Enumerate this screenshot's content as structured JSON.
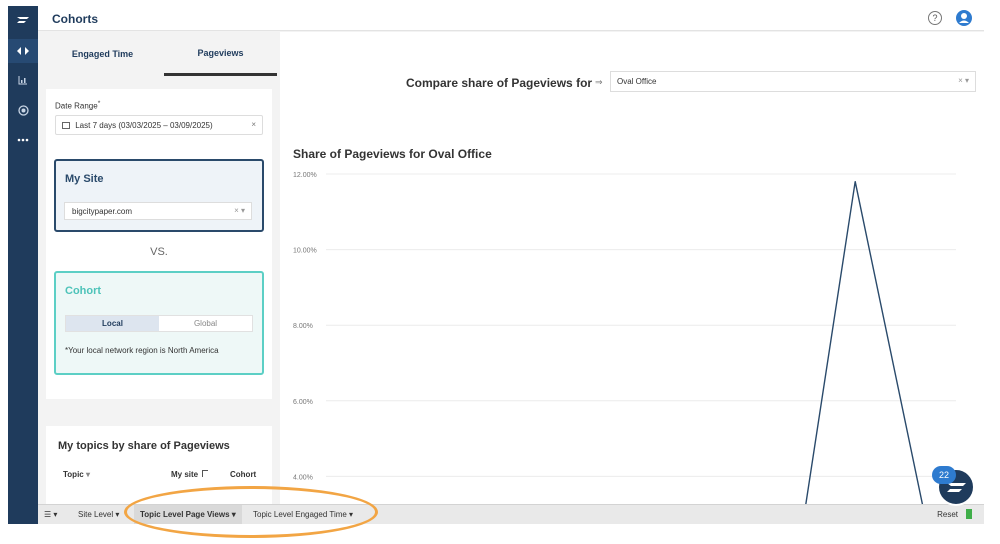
{
  "header": {
    "title": "Cohorts",
    "help_glyph": "?"
  },
  "tabs": [
    {
      "label": "Engaged Time"
    },
    {
      "label": "Pageviews",
      "active": true
    }
  ],
  "filters": {
    "date_range_label": "Date Range",
    "required_mark": "*",
    "date_range_value": "Last 7 days (03/03/2025 – 03/09/2025)",
    "clear_glyph": "×",
    "my_site": {
      "title": "My Site",
      "value": "bigcitypaper.com",
      "ctrl_glyphs": "× ▾"
    },
    "vs": "VS.",
    "cohort": {
      "title": "Cohort",
      "options": [
        "Local",
        "Global"
      ],
      "selected": "Local",
      "note": "*Your local network region is North America"
    }
  },
  "topics": {
    "title": "My topics by share of Pageviews",
    "columns": [
      "Topic",
      "My site",
      "Cohort"
    ],
    "sort_glyph": "▾"
  },
  "compare": {
    "label": "Compare share of Pageviews for",
    "arrow_glyph": "⇒",
    "value": "Oval Office",
    "ctrl_glyphs": "× ▾"
  },
  "chart_data": {
    "type": "line",
    "title": "Share of Pageviews for Oval Office",
    "y_tick_labels": [
      "12.00%",
      "10.00%",
      "8.00%",
      "6.00%",
      "4.00%"
    ],
    "ylim": [
      2.0,
      12.0
    ],
    "series": [
      {
        "x": [
          0.75,
          0.84,
          0.95
        ],
        "values": [
          2.0,
          11.8,
          3.0
        ],
        "color": "#2a4a6b"
      }
    ],
    "grid": true
  },
  "bottom_tabs": {
    "menu_glyph": "☰ ▾",
    "items": [
      "Site Level ▾",
      "Topic Level Page Views ▾",
      "Topic Level Engaged Time ▾"
    ],
    "reset": "Reset"
  },
  "notifications": {
    "count": "22"
  },
  "colors": {
    "nav": "#1f3b5c",
    "accent": "#2e7bcf",
    "cohort": "#4dc3b9",
    "highlight": "#f2a544"
  }
}
